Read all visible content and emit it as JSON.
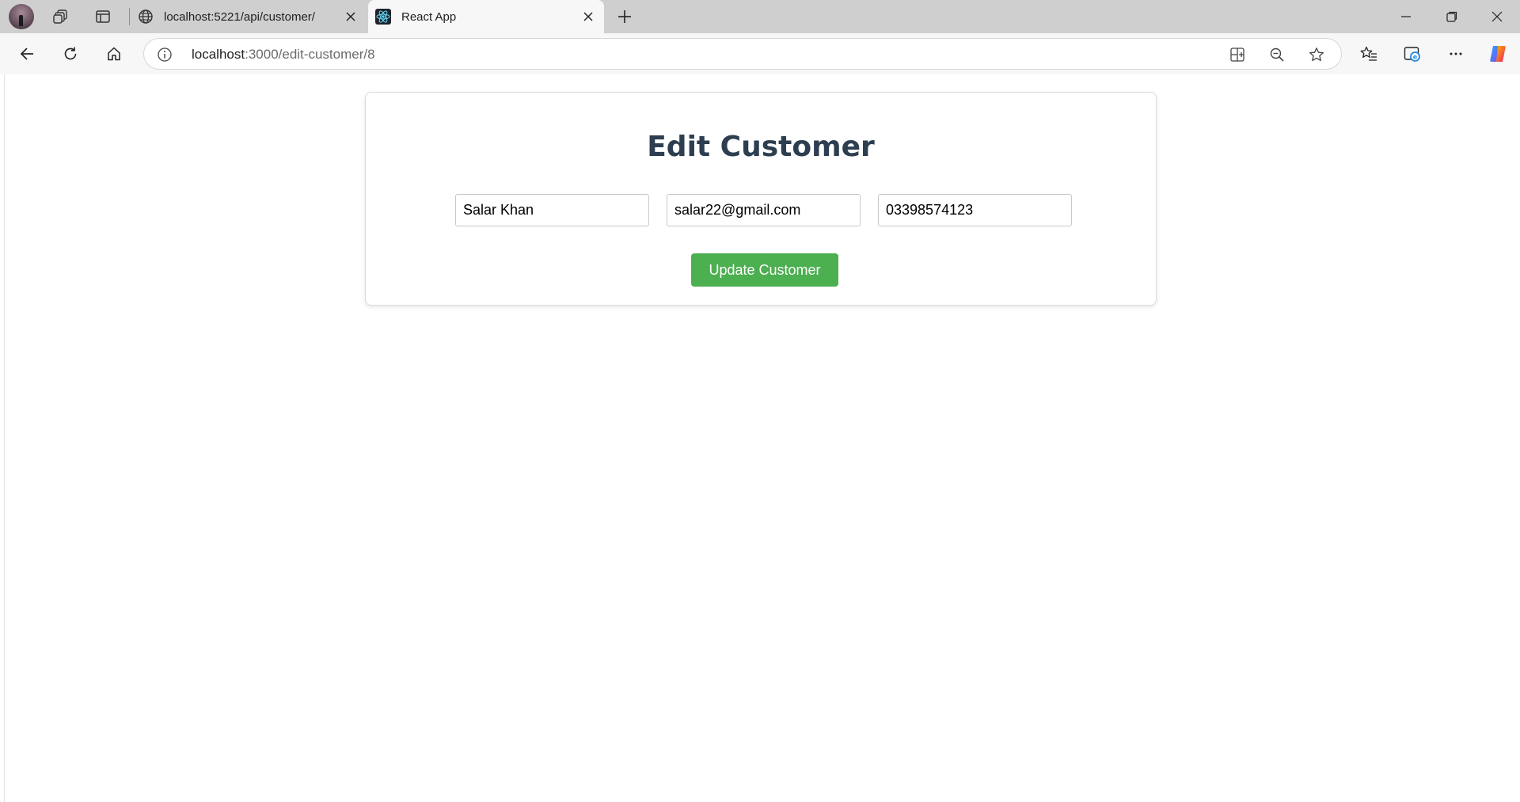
{
  "browser": {
    "tabs": [
      {
        "title": "localhost:5221/api/customer/",
        "icon": "globe-icon"
      },
      {
        "title": "React App",
        "icon": "react-icon"
      }
    ],
    "url": {
      "host": "localhost",
      "rest": ":3000/edit-customer/8"
    }
  },
  "form": {
    "title": "Edit Customer",
    "name_value": "Salar Khan",
    "email_value": "salar22@gmail.com",
    "phone_value": "03398574123",
    "submit_label": "Update Customer"
  },
  "colors": {
    "accent_button": "#4caf50",
    "heading": "#2c3e50"
  }
}
